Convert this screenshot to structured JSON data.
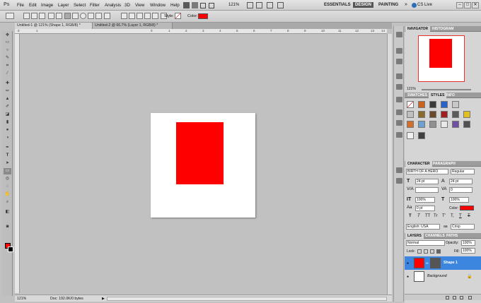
{
  "app": {
    "logo": "Ps"
  },
  "menus": [
    "File",
    "Edit",
    "Image",
    "Layer",
    "Select",
    "Filter",
    "Analysis",
    "3D",
    "View",
    "Window",
    "Help"
  ],
  "zoom_menu": "121%",
  "workspaces": [
    "ESSENTIALS",
    "DESIGN",
    "PAINTING"
  ],
  "cslive": "CS Live",
  "window_buttons": [
    "–",
    "□",
    "✕"
  ],
  "options": {
    "style_label": "Style:",
    "color_label": "Color:",
    "color": "#ff0000"
  },
  "tabs": [
    "Untitled-1 @ 121% (Shape 1, RGB/8) *",
    "Untitled-2 @ 66.7% (Layer 1, RGB/8) *"
  ],
  "ruler_ticks": [
    "0",
    "1",
    "0",
    "1",
    "2",
    "3",
    "4",
    "5",
    "6",
    "7",
    "8",
    "9",
    "10",
    "11",
    "12",
    "13",
    "14"
  ],
  "status": {
    "zoom": "121%",
    "doc": "Doc: 192.0K/0 bytes"
  },
  "canvas": {
    "shape_color": "#ff0000"
  },
  "navigator": {
    "tabs": [
      "NAVIGATOR",
      "HISTOGRAM"
    ],
    "zoom": "121%"
  },
  "swatches_panel": {
    "tabs": [
      "SWATCHES",
      "STYLES",
      "INFO"
    ]
  },
  "character": {
    "tabs": [
      "CHARACTER",
      "PARAGRAPH"
    ],
    "font": "BIRTH OF A HERO",
    "style": "Regular",
    "size": "24 pt",
    "leading": "24 pt",
    "kerning": "",
    "tracking": "0",
    "vscale": "100%",
    "hscale": "100%",
    "baseline": "0 pt",
    "color_label": "Color:",
    "color": "#ff0000",
    "language": "English: USA",
    "aa_label": "aa",
    "antialias": "Crisp",
    "style_buttons": [
      "T",
      "T",
      "TT",
      "Tr",
      "T'",
      "T,",
      "T",
      "T"
    ]
  },
  "layers": {
    "tabs": [
      "LAYERS",
      "CHANNELS",
      "PATHS"
    ],
    "blend": "Normal",
    "opacity_label": "Opacity:",
    "opacity": "100%",
    "lock_label": "Lock:",
    "fill_label": "Fill:",
    "fill": "100%",
    "items": [
      {
        "name": "Shape 1",
        "selected": true
      },
      {
        "name": "Background",
        "selected": false
      }
    ]
  }
}
